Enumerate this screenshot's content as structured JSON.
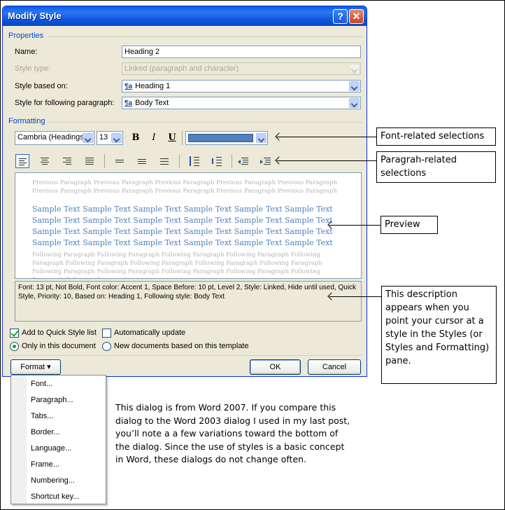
{
  "dialog": {
    "title": "Modify Style",
    "help_glyph": "?",
    "close_glyph": "✕",
    "properties_label": "Properties",
    "name_label": "Name:",
    "name_value": "Heading 2",
    "style_type_label": "Style type:",
    "style_type_value": "Linked (paragraph and character)",
    "based_on_label": "Style based on:",
    "based_on_value": "Heading 1",
    "following_label": "Style for following paragraph:",
    "following_value": "Body Text",
    "style_icon": "¶a",
    "formatting_label": "Formatting",
    "font_value": "Cambria (Headings)",
    "size_value": "13",
    "bold": "B",
    "italic": "I",
    "underline": "U",
    "font_color": "#4f81bd",
    "preview": {
      "previous": "Previous Paragraph Previous Paragraph Previous Paragraph Previous Paragraph Previous Paragraph Previous Paragraph Previous Paragraph Previous Paragraph Previous Paragraph Previous Paragraph",
      "sample": "Sample Text Sample Text Sample Text Sample Text Sample Text Sample Text Sample Text Sample Text Sample Text Sample Text Sample Text Sample Text Sample Text Sample Text Sample Text Sample Text Sample Text Sample Text Sample Text Sample Text Sample Text Sample Text Sample Text Sample Text",
      "following": "Following Paragraph Following Paragraph Following Paragraph Following Paragraph Following Paragraph Following Paragraph Following Paragraph Following Paragraph Following Paragraph Following Paragraph Following Paragraph Following Paragraph Following Paragraph Following Paragraph Following Paragraph"
    },
    "description": "Font: 13 pt, Not Bold, Font color: Accent 1, Space Before:  10 pt, Level 2, Style: Linked, Hide until used, Quick Style, Priority: 10, Based on: Heading 1, Following style: Body Text",
    "add_quick_style": "Add to Quick Style list",
    "auto_update": "Automatically update",
    "only_this_doc": "Only in this document",
    "new_docs": "New documents based on this template",
    "format_button": "Format ▾",
    "ok_button": "OK",
    "cancel_button": "Cancel"
  },
  "format_menu": {
    "items": [
      "Font...",
      "Paragraph...",
      "Tabs...",
      "Border...",
      "Language...",
      "Frame...",
      "Numbering...",
      "Shortcut key..."
    ]
  },
  "callouts": {
    "font": "Font-related selections",
    "paragraph": "Paragrah-related selections",
    "preview": "Preview",
    "description": "This description appears when you point your cursor at a style in the Styles (or Styles and Formatting) pane."
  },
  "caption": "This dialog is from Word 2007. If you compare this dialog to the Word 2003 dialog I used in my last post, you’ll note a a few variations toward the bottom of the dialog. Since the use of  styles is a basic concept in Word, these dialogs do not change often."
}
